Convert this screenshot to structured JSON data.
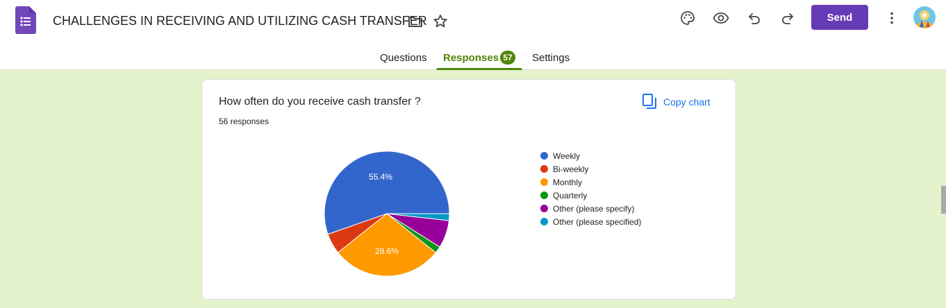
{
  "header": {
    "title": "CHALLENGES IN RECEIVING AND UTILIZING CASH TRANSFER",
    "send_label": "Send",
    "icons": [
      "forms-logo-icon",
      "folder-icon",
      "star-icon",
      "palette-icon",
      "eye-icon",
      "undo-icon",
      "redo-icon",
      "more-vert-icon",
      "avatar"
    ],
    "accent_color": "#673ab7"
  },
  "tabs": [
    {
      "label": "Questions",
      "active": false
    },
    {
      "label": "Responses",
      "active": true,
      "badge": "57"
    },
    {
      "label": "Settings",
      "active": false
    }
  ],
  "card": {
    "question": "How often do you receive cash transfer ?",
    "responses": "56 responses",
    "copy_label": "Copy chart"
  },
  "chart_data": {
    "type": "pie",
    "total_responses": 56,
    "categories": [
      "Weekly",
      "Bi-weekly",
      "Monthly",
      "Quarterly",
      "Other (please specify)",
      "Other (please specified)"
    ],
    "values": [
      31,
      3,
      16,
      1,
      4,
      1
    ],
    "labels": [
      "55.4%",
      "",
      "28.6%",
      "",
      "",
      ""
    ],
    "colors": [
      "#3366cc",
      "#dc3912",
      "#ff9900",
      "#109618",
      "#990099",
      "#0099c6"
    ],
    "legend_position": "right"
  }
}
